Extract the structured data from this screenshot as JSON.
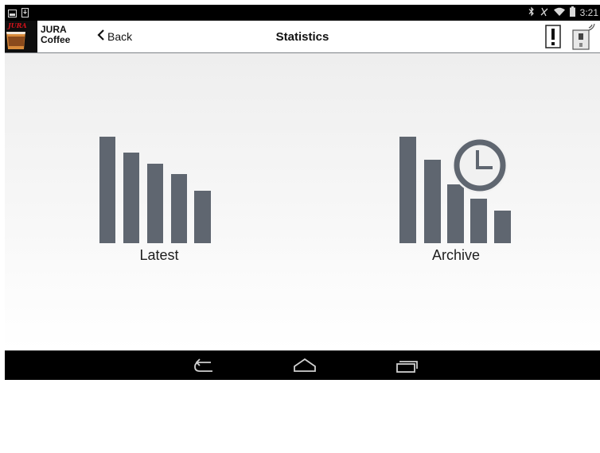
{
  "status_bar": {
    "time": "3:21",
    "icons": [
      "screenshot-icon",
      "download-icon",
      "bluetooth-icon",
      "mute-icon",
      "wifi-icon",
      "battery-icon"
    ]
  },
  "app_bar": {
    "brand_logo": "JURA",
    "brand_name": "JURA\nCoffee",
    "back_label": "Back",
    "title": "Statistics",
    "icons": [
      "alert-icon",
      "coffee-machine-icon"
    ]
  },
  "tiles": [
    {
      "label": "Latest",
      "icon": "bar-chart-icon"
    },
    {
      "label": "Archive",
      "icon": "bar-chart-clock-icon"
    }
  ],
  "nav_bar": {
    "icons": [
      "back-nav-icon",
      "home-nav-icon",
      "recents-nav-icon"
    ]
  },
  "colors": {
    "accent": "#5f6670",
    "background": "#f3f3f3",
    "text": "#1e1e1e",
    "brand_red": "#d4121a"
  }
}
